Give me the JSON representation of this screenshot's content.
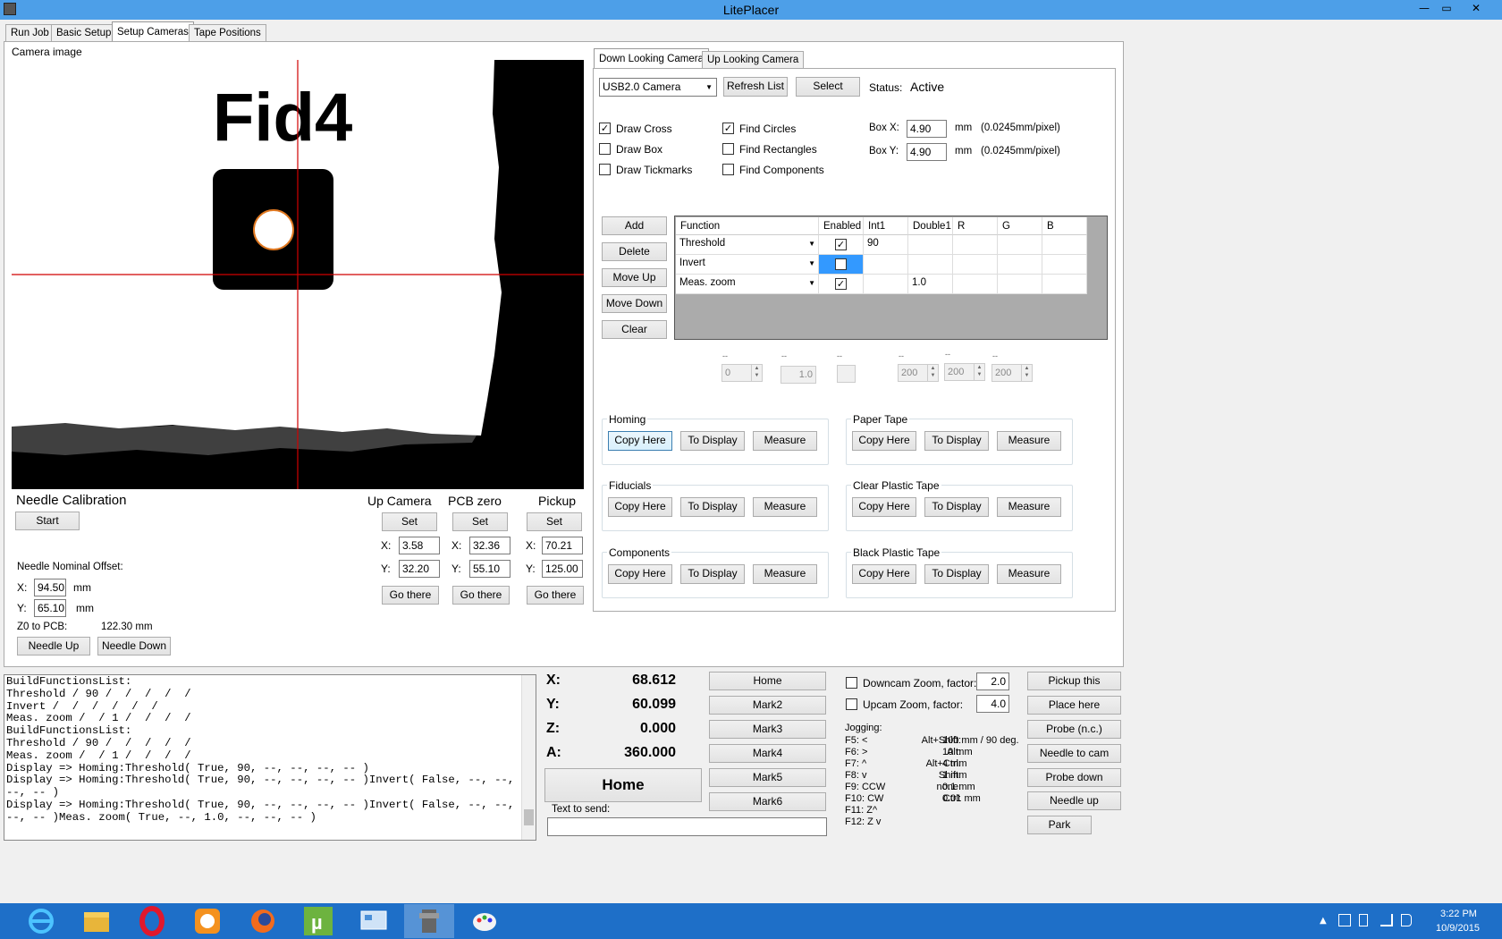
{
  "window": {
    "title": "LitePlacer",
    "minimize": "—",
    "maximize": "▭",
    "close": "✕"
  },
  "tabs": [
    "Run Job",
    "Basic Setup",
    "Setup Cameras",
    "Tape Positions"
  ],
  "camera_image": {
    "label": "Camera image",
    "text": "Fid4"
  },
  "needle_cal": {
    "title": "Needle Calibration",
    "start": "Start",
    "offset_label": "Needle Nominal Offset:",
    "x_label": "X:",
    "x_value": "94.50",
    "y_label": "Y:",
    "y_value": "65.10",
    "unit": "mm",
    "z0_label": "Z0 to PCB:",
    "z0_value": "122.30 mm",
    "needle_up": "Needle Up",
    "needle_down": "Needle Down"
  },
  "positions": {
    "up_camera": {
      "title": "Up Camera",
      "set": "Set",
      "x": "3.58",
      "y": "32.20",
      "go": "Go there"
    },
    "pcb_zero": {
      "title": "PCB zero",
      "set": "Set",
      "x": "32.36",
      "y": "55.10",
      "go": "Go there"
    },
    "pickup": {
      "title": "Pickup",
      "set": "Set",
      "x": "70.21",
      "y": "125.00",
      "go": "Go there"
    },
    "x_label": "X:",
    "y_label": "Y:"
  },
  "cam_tabs": [
    "Down Looking Camera",
    "Up Looking Camera"
  ],
  "camera_select": {
    "value": "USB2.0 Camera",
    "refresh": "Refresh List",
    "select": "Select",
    "status_label": "Status:",
    "status_value": "Active"
  },
  "checks": {
    "draw_cross": "Draw Cross",
    "draw_box": "Draw Box",
    "draw_tick": "Draw Tickmarks",
    "find_circles": "Find Circles",
    "find_rect": "Find Rectangles",
    "find_comp": "Find Components",
    "check": "✓"
  },
  "box": {
    "x_label": "Box X:",
    "x_value": "4.90",
    "y_label": "Box Y:",
    "y_value": "4.90",
    "unit": "mm",
    "scale": "(0.0245mm/pixel)"
  },
  "func_buttons": {
    "add": "Add",
    "delete": "Delete",
    "move_up": "Move Up",
    "move_down": "Move Down",
    "clear": "Clear"
  },
  "func_grid": {
    "headers": [
      "Function",
      "Enabled",
      "Int1",
      "Double1",
      "R",
      "G",
      "B"
    ],
    "rows": [
      {
        "fn": "Threshold",
        "int1": "90",
        "double1": ""
      },
      {
        "fn": "Invert",
        "int1": "",
        "double1": ""
      },
      {
        "fn": "Meas. zoom",
        "int1": "",
        "double1": "1.0"
      }
    ]
  },
  "param_row": {
    "dash": "--",
    "v0": "0",
    "v1": "1.0",
    "v3": "200",
    "v4": "200",
    "v5": "200"
  },
  "groups": {
    "homing": "Homing",
    "paper": "Paper Tape",
    "fiducials": "Fiducials",
    "clear_plastic": "Clear Plastic Tape",
    "components": "Components",
    "black_plastic": "Black Plastic Tape",
    "copy": "Copy Here",
    "to_display": "To Display",
    "measure": "Measure"
  },
  "log": [
    "BuildFunctionsList:",
    "Threshold / 90 /  /  /  /  /",
    "Invert /  /  /  /  /  /",
    "Meas. zoom /  / 1 /  /  /  /",
    "BuildFunctionsList:",
    "Threshold / 90 /  /  /  /  /",
    "Meas. zoom /  / 1 /  /  /  /",
    "Display => Homing:Threshold( True, 90, --, --, --, -- )",
    "Display => Homing:Threshold( True, 90, --, --, --, -- )Invert( False, --, --, --,",
    "--, -- )",
    "Display => Homing:Threshold( True, 90, --, --, --, -- )Invert( False, --, --, --,",
    "--, -- )Meas. zoom( True, --, 1.0, --, --, -- )"
  ],
  "coords": {
    "x_label": "X:",
    "x": "68.612",
    "y_label": "Y:",
    "y": "60.099",
    "z_label": "Z:",
    "z": "0.000",
    "a_label": "A:",
    "a": "360.000",
    "home": "Home",
    "text_to_send": "Text to send:"
  },
  "marks": [
    "Home",
    "Mark2",
    "Mark3",
    "Mark4",
    "Mark5",
    "Mark6"
  ],
  "zoom": {
    "down_label": "Downcam Zoom, factor:",
    "down_value": "2.0",
    "up_label": "Upcam Zoom, factor:",
    "up_value": "4.0"
  },
  "jogging": {
    "title": "Jogging:",
    "left": [
      "F5: <",
      "F6: >",
      "F7: ^",
      "F8: v",
      "F9: CCW",
      "F10: CW",
      "F11: Z^",
      "F12: Z v"
    ],
    "mods": [
      "Alt+Shift:",
      "Alt:",
      "Alt+Ctrl:",
      "Shift:",
      "none:",
      "Ctrl:"
    ],
    "vals": [
      "100 mm / 90 deg.",
      "10 mm",
      "4 mm",
      "1 mm",
      "0.1 mm",
      "0.01 mm"
    ]
  },
  "right_buttons": [
    "Pickup this",
    "Place here",
    "Probe (n.c.)",
    "Needle to cam",
    "Probe down",
    "Needle up",
    "Park"
  ],
  "taskbar": {
    "time": "3:22 PM",
    "date": "10/9/2015"
  }
}
